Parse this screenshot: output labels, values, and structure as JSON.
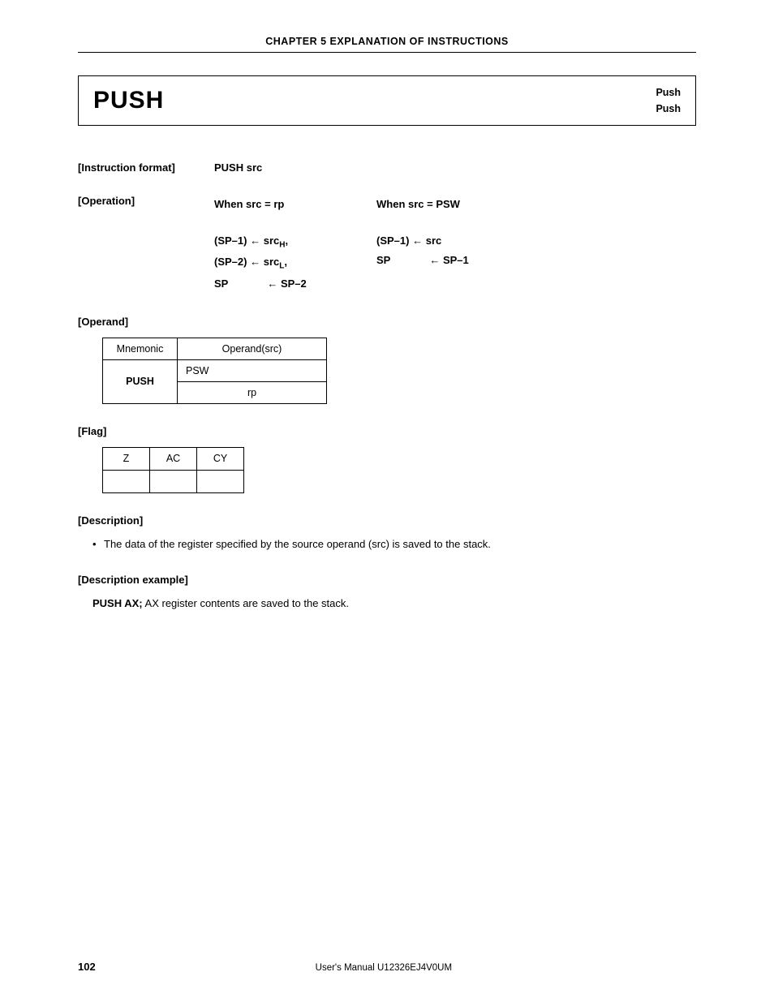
{
  "chapter_header": "CHAPTER 5  EXPLANATION OF INSTRUCTIONS",
  "title": {
    "mnemonic": "PUSH",
    "right1": "Push",
    "right2": "Push"
  },
  "instruction_format": {
    "label": "[Instruction format]",
    "value": "PUSH src"
  },
  "operation": {
    "label": "[Operation]",
    "cols": [
      {
        "heading": "When  src  =  rp",
        "lines": [
          {
            "lhs": "(SP–1)",
            "arrow": "←",
            "rhs": "src",
            "sub": "H",
            "suffix": ","
          },
          {
            "lhs": "(SP–2)",
            "arrow": "←",
            "rhs": "src",
            "sub": "L",
            "suffix": ","
          },
          {
            "lhs": "SP",
            "arrow": "←",
            "rhs": "SP–2",
            "sub": "",
            "suffix": "",
            "sp_pad": true
          }
        ]
      },
      {
        "heading": "When  src  =  PSW",
        "lines": [
          {
            "lhs": "(SP–1)",
            "arrow": "←",
            "rhs": "src",
            "sub": "",
            "suffix": ""
          },
          {
            "lhs": "SP",
            "arrow": "←",
            "rhs": "SP–1",
            "sub": "",
            "suffix": "",
            "sp_pad": true
          }
        ]
      }
    ]
  },
  "operand": {
    "label": "[Operand]",
    "headers": [
      "Mnemonic",
      "Operand(src)"
    ],
    "mnemonic": "PUSH",
    "rows": [
      "PSW",
      "rp"
    ]
  },
  "flag": {
    "label": "[Flag]",
    "headers": [
      "Z",
      "AC",
      "CY"
    ],
    "values": [
      "",
      "",
      ""
    ]
  },
  "description": {
    "label": "[Description]",
    "bullet": "•",
    "text": "The data of the register specified by the source operand (src) is saved to the stack."
  },
  "description_example": {
    "label": "[Description example]",
    "bold": "PUSH AX;",
    "text": "  AX register contents are saved to the stack."
  },
  "footer": {
    "page": "102",
    "text": "User's Manual  U12326EJ4V0UM"
  },
  "chart_data": {
    "type": "table",
    "tables": [
      {
        "name": "operand",
        "headers": [
          "Mnemonic",
          "Operand(src)"
        ],
        "rows": [
          [
            "PUSH",
            "PSW"
          ],
          [
            "",
            "rp"
          ]
        ]
      },
      {
        "name": "flag",
        "headers": [
          "Z",
          "AC",
          "CY"
        ],
        "rows": [
          [
            "",
            "",
            ""
          ]
        ]
      }
    ]
  }
}
